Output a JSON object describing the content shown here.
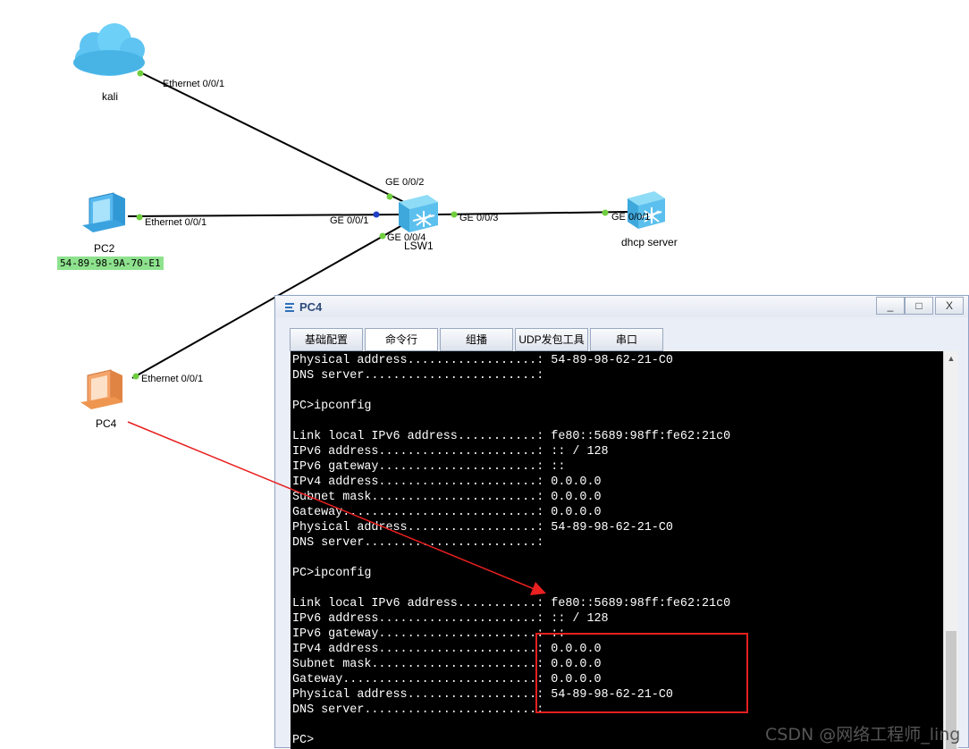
{
  "topology": {
    "devices": {
      "kali": "kali",
      "pc2": "PC2",
      "pc2_mac": "54-89-98-9A-70-E1",
      "pc4": "PC4",
      "lsw1": "LSW1",
      "dhcp_server": "dhcp server"
    },
    "ports": {
      "kali_eth": "Ethernet 0/0/1",
      "pc2_eth": "Ethernet 0/0/1",
      "pc4_eth": "Ethernet 0/0/1",
      "sw_ge1": "GE 0/0/1",
      "sw_ge2": "GE 0/0/2",
      "sw_ge3": "GE 0/0/3",
      "sw_ge4": "GE 0/0/4",
      "dhcp_ge1": "GE 0/0/1"
    },
    "colors": {
      "port_dot": "#6fcf3f",
      "link": "#000000",
      "arrow": "#e82020"
    }
  },
  "window": {
    "title": "PC4",
    "buttons": {
      "minimize": "_",
      "maximize": "□",
      "close": "X"
    },
    "tabs": [
      "基础配置",
      "命令行",
      "组播",
      "UDP发包工具",
      "串口"
    ],
    "active_tab": "命令行",
    "console_lines": [
      "Physical address..................: 54-89-98-62-21-C0",
      "DNS server........................:",
      "",
      "PC>ipconfig",
      "",
      "Link local IPv6 address...........: fe80::5689:98ff:fe62:21c0",
      "IPv6 address......................: :: / 128",
      "IPv6 gateway......................: ::",
      "IPv4 address......................: 0.0.0.0",
      "Subnet mask.......................: 0.0.0.0",
      "Gateway...........................: 0.0.0.0",
      "Physical address..................: 54-89-98-62-21-C0",
      "DNS server........................:",
      "",
      "PC>ipconfig",
      "",
      "Link local IPv6 address...........: fe80::5689:98ff:fe62:21c0",
      "IPv6 address......................: :: / 128",
      "IPv6 gateway......................: ::",
      "IPv4 address......................: 0.0.0.0",
      "Subnet mask.......................: 0.0.0.0",
      "Gateway...........................: 0.0.0.0",
      "Physical address..................: 54-89-98-62-21-C0",
      "DNS server........................:",
      "",
      "PC>"
    ]
  },
  "watermark": "CSDN @网络工程师_ling"
}
